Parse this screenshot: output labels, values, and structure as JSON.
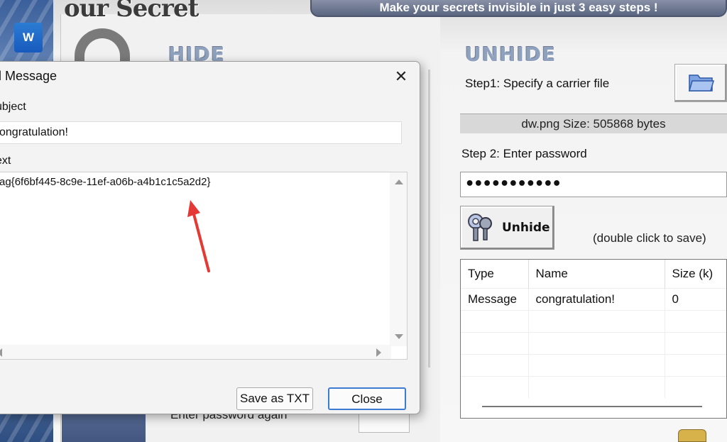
{
  "app": {
    "logo_text": "our Secret",
    "tagline": "Make your secrets invisible in just 3 easy steps !",
    "hide_title": "HIDE",
    "unhide_title": "UNHIDE",
    "hide_password_again_label": "Enter password again"
  },
  "unhide": {
    "step1_label": "Step1: Specify a carrier file",
    "file_info": "dw.png   Size: 505868 bytes",
    "step2_label": "Step 2: Enter password",
    "password_mask": "•••••••••••",
    "unhide_button": "Unhide",
    "double_click_hint": "(double click to save)",
    "table": {
      "headers": [
        "Type",
        "Name",
        "Size (k)"
      ],
      "rows": [
        [
          "Message",
          "congratulation!",
          "0"
        ]
      ]
    }
  },
  "dialog": {
    "title": "d Message",
    "subject_label": "ubject",
    "subject_value": "ongratulation!",
    "text_label": "ext",
    "text_value": "ag{6f6bf445-8c9e-11ef-a06b-a4b1c1c5a2d2}",
    "save_txt_button": "Save as TXT",
    "close_button": "Close",
    "close_x": "✕"
  },
  "desktop": {
    "word_icon_letter": "W"
  },
  "colors": {
    "annotation_arrow": "#e53935",
    "focus_border": "#3b7bd4"
  }
}
